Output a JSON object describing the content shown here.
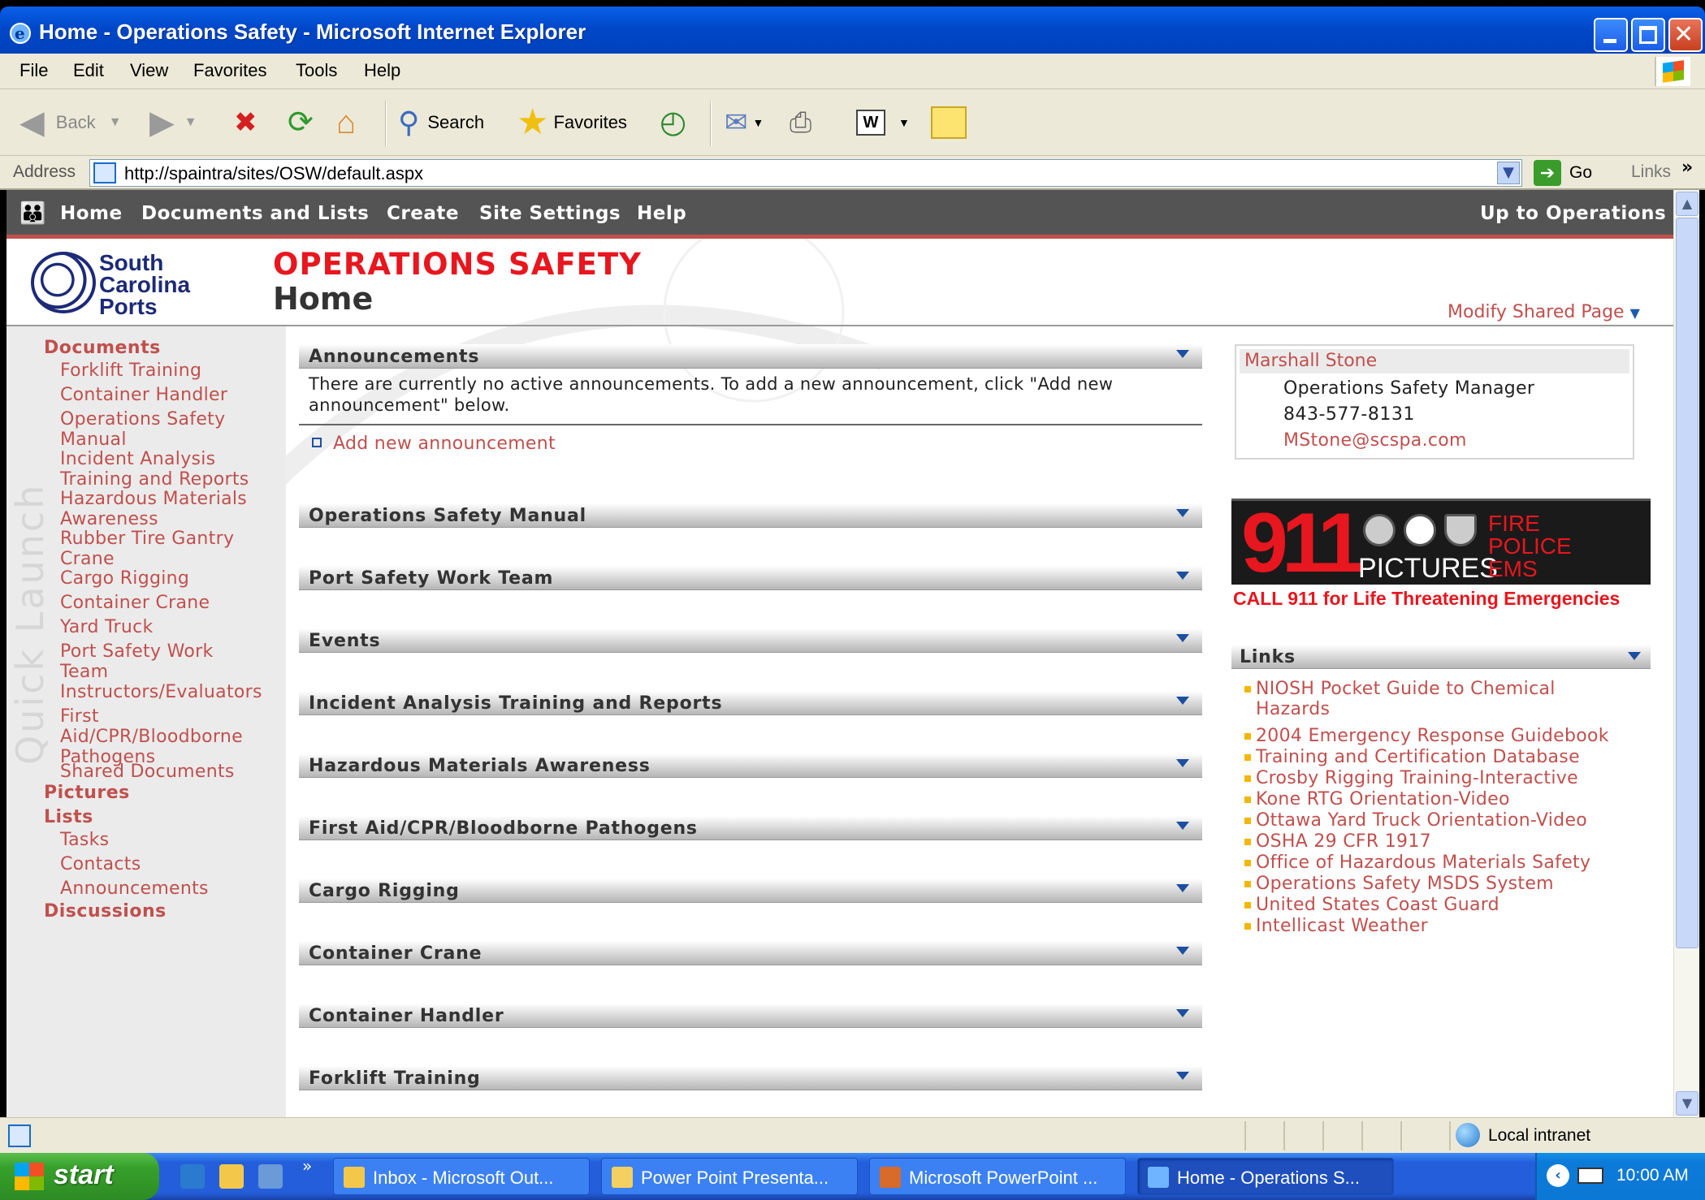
{
  "window": {
    "title": "Home - Operations Safety - Microsoft Internet Explorer"
  },
  "menu": [
    "File",
    "Edit",
    "View",
    "Favorites",
    "Tools",
    "Help"
  ],
  "toolbar": {
    "back": "Back",
    "search": "Search",
    "favorites": "Favorites"
  },
  "address": {
    "label": "Address",
    "url": "http://spaintra/sites/OSW/default.aspx",
    "go": "Go",
    "links": "Links"
  },
  "sp_nav": {
    "items": [
      "Home",
      "Documents and Lists",
      "Create",
      "Site Settings",
      "Help"
    ],
    "up": "Up to Operations"
  },
  "logo": {
    "line1": "South",
    "line2": "Carolina",
    "line3": "Ports"
  },
  "site": {
    "title": "OPERATIONS SAFETY",
    "page": "Home",
    "modify": "Modify Shared Page"
  },
  "quick_launch": {
    "watermark": "Quick Launch",
    "documents": "Documents",
    "doc_items": [
      "Forklift Training",
      "Container Handler",
      "Operations Safety Manual",
      "Incident Analysis Training and Reports",
      "Hazardous Materials Awareness",
      "Rubber Tire Gantry Crane",
      "Cargo Rigging",
      "Container Crane",
      "Yard Truck",
      "Port Safety Work Team",
      "Instructors/Evaluators",
      "First Aid/CPR/Bloodborne Pathogens",
      "Shared Documents"
    ],
    "pictures": "Pictures",
    "lists": "Lists",
    "list_items": [
      "Tasks",
      "Contacts",
      "Announcements"
    ],
    "discussions": "Discussions"
  },
  "announcements": {
    "title": "Announcements",
    "body": "There are currently no active announcements. To add a new announcement, click \"Add new announcement\" below.",
    "add": "Add new announcement"
  },
  "webparts": [
    "Operations Safety Manual",
    "Port Safety Work Team",
    "Events",
    "Incident Analysis Training and Reports",
    "Hazardous Materials Awareness",
    "First Aid/CPR/Bloodborne Pathogens",
    "Cargo Rigging",
    "Container Crane",
    "Container Handler",
    "Forklift Training"
  ],
  "contact": {
    "name": "Marshall Stone",
    "role": "Operations Safety Manager",
    "phone": "843-577-8131",
    "email": "MStone@scspa.com"
  },
  "banner": {
    "number": "911",
    "pictures": "PICTURES",
    "fire": "FIRE",
    "police": "POLICE",
    "ems": "EMS",
    "call": "CALL 911 for Life Threatening Emergencies"
  },
  "links": {
    "title": "Links",
    "items": [
      "NIOSH Pocket Guide to Chemical Hazards",
      "2004 Emergency Response Guidebook",
      "Training and Certification Database",
      "Crosby Rigging Training-Interactive",
      "Kone RTG Orientation-Video",
      "Ottawa Yard Truck Orientation-Video",
      "OSHA 29 CFR 1917",
      "Office of Hazardous Materials Safety",
      "Operations Safety MSDS System",
      "United States Coast Guard",
      "Intellicast Weather"
    ]
  },
  "status": {
    "zone": "Local intranet"
  },
  "taskbar": {
    "start": "start",
    "tasks": [
      "Inbox - Microsoft Out...",
      "Power Point Presenta...",
      "Microsoft PowerPoint ...",
      "Home - Operations S..."
    ],
    "clock": "10:00 AM"
  },
  "colors": {
    "accent_red": "#c0504d",
    "title_red": "#e8161e",
    "nav_bg": "#545454",
    "xp_blue": "#245edb"
  }
}
